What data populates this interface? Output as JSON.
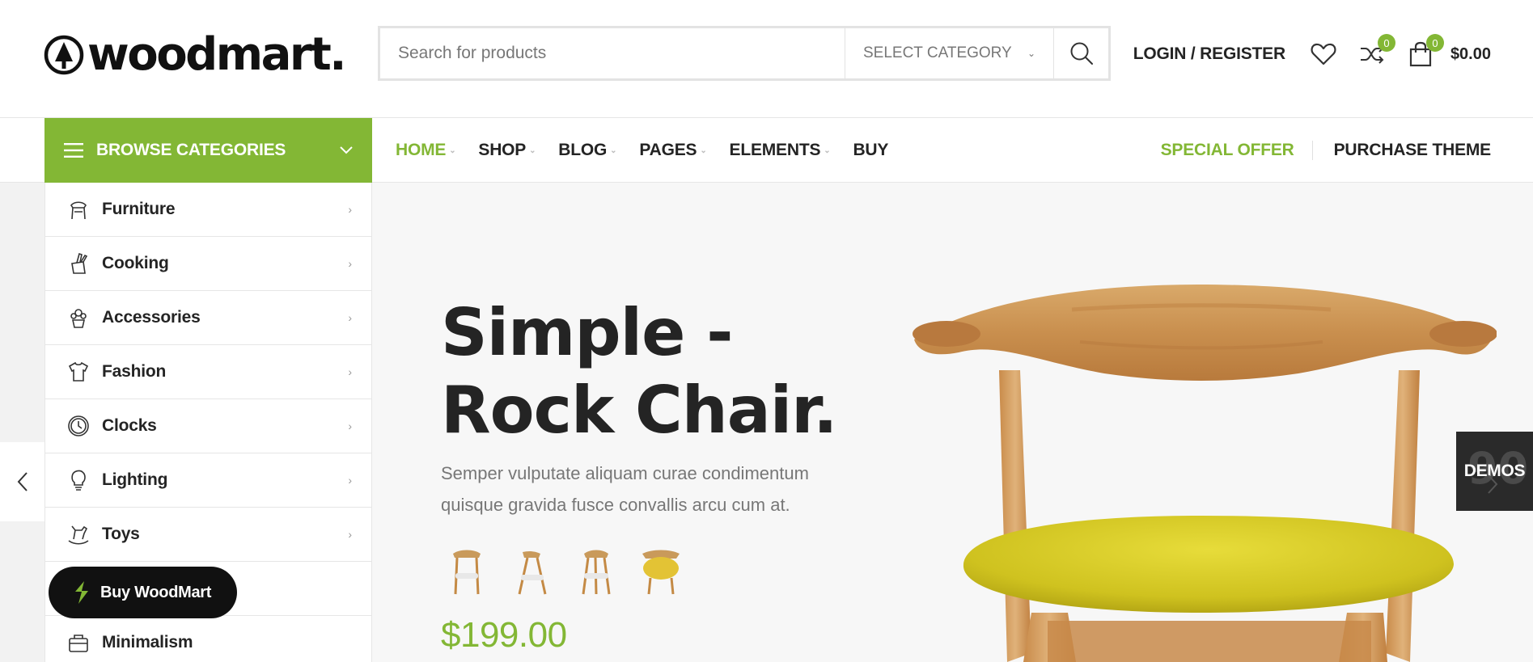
{
  "colors": {
    "accent": "#83b735",
    "text": "#242424",
    "muted": "#777777",
    "dark": "#111111"
  },
  "header": {
    "logo_text": "woodmart.",
    "search": {
      "placeholder": "Search for products",
      "category_label": "SELECT CATEGORY"
    },
    "login_label": "LOGIN / REGISTER",
    "compare_count": "0",
    "cart_count": "0",
    "cart_total": "$0.00"
  },
  "nav": {
    "browse_label": "BROWSE CATEGORIES",
    "items": [
      {
        "label": "HOME",
        "has_dropdown": true,
        "active": true
      },
      {
        "label": "SHOP",
        "has_dropdown": true
      },
      {
        "label": "BLOG",
        "has_dropdown": true
      },
      {
        "label": "PAGES",
        "has_dropdown": true
      },
      {
        "label": "ELEMENTS",
        "has_dropdown": true
      },
      {
        "label": "BUY",
        "has_dropdown": false
      }
    ],
    "special_offer": "SPECIAL OFFER",
    "purchase_theme": "PURCHASE THEME"
  },
  "categories": [
    {
      "label": "Furniture",
      "icon": "chair-icon"
    },
    {
      "label": "Cooking",
      "icon": "knife-block-icon"
    },
    {
      "label": "Accessories",
      "icon": "plant-pot-icon"
    },
    {
      "label": "Fashion",
      "icon": "shirt-icon"
    },
    {
      "label": "Clocks",
      "icon": "clock-icon"
    },
    {
      "label": "Lighting",
      "icon": "light-bulb-icon"
    },
    {
      "label": "Toys",
      "icon": "rocking-horse-icon"
    },
    {
      "label": "",
      "icon": ""
    },
    {
      "label": "Minimalism",
      "icon": "bag-icon"
    }
  ],
  "buy_button": {
    "label": "Buy WoodMart"
  },
  "hero": {
    "title_line1": "Simple -",
    "title_line2": "Rock Chair.",
    "description_line1": "Semper vulputate aliquam curae condimentum",
    "description_line2": "quisque gravida fusce convallis arcu cum at.",
    "price": "$199.00",
    "thumbnail_colors": [
      "#e8e8e8",
      "#e8e8e8",
      "#e8e8e8",
      "#e3c335"
    ]
  },
  "demos": {
    "label": "DEMOS",
    "background_number": "90"
  }
}
